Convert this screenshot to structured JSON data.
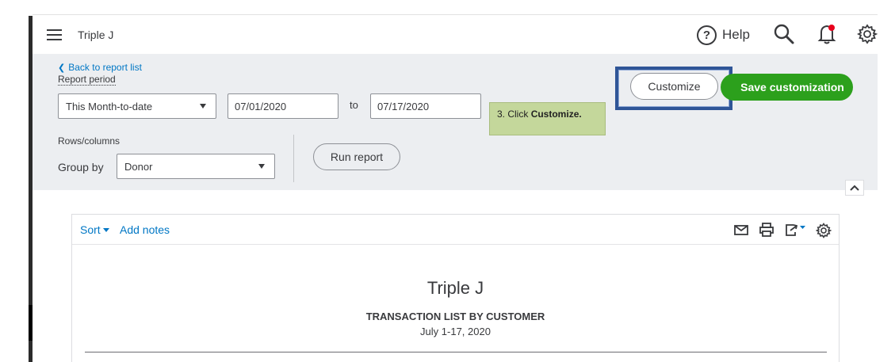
{
  "topbar": {
    "company_name": "Triple J",
    "help_label": "Help",
    "help_glyph": "?"
  },
  "filters": {
    "back_link": "Back to report list",
    "report_period_label": "Report period",
    "period_value": "This Month-to-date",
    "date_from": "07/01/2020",
    "to_label": "to",
    "date_to": "07/17/2020",
    "rows_columns_label": "Rows/columns",
    "group_by_label": "Group by",
    "group_by_value": "Donor",
    "run_report_label": "Run report",
    "customize_label": "Customize",
    "save_customization_label": "Save customization"
  },
  "tip": {
    "prefix": "3. Click ",
    "bold": "Customize."
  },
  "report": {
    "sort_label": "Sort",
    "add_notes_label": "Add notes",
    "company": "Triple J",
    "title": "TRANSACTION LIST BY CUSTOMER",
    "date_range": "July 1-17, 2020"
  },
  "colors": {
    "primary_green": "#2ca01c",
    "link_blue": "#0077c5",
    "highlight_frame": "#2f5597",
    "tip_background": "#c4d79b",
    "panel_background": "#eceef1",
    "notification_dot": "#e8001c"
  },
  "icons": {
    "menu": "hamburger-icon",
    "help": "help-circle-icon",
    "search": "search-icon",
    "notifications": "bell-icon",
    "settings": "gear-icon",
    "back": "chevron-left-icon",
    "dropdown": "caret-down-icon",
    "collapse": "chevron-up-icon",
    "email": "mail-icon",
    "print": "printer-icon",
    "export": "export-icon",
    "report_settings": "gear-icon"
  }
}
